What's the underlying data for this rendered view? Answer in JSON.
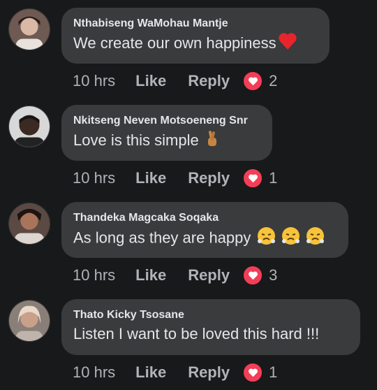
{
  "colors": {
    "background": "#18191a",
    "bubble": "#3a3b3c",
    "text_primary": "#e4e6eb",
    "text_secondary": "#b0b3b8",
    "love_reaction": "#f33e58"
  },
  "comments": [
    {
      "author": "Nthabiseng WaMohau Mantje",
      "text": "We create our own happiness",
      "emoji": "red-heart-emoji",
      "time": "10 hrs",
      "like_label": "Like",
      "reply_label": "Reply",
      "reaction_icon": "love-reaction-icon",
      "reaction_count": "2"
    },
    {
      "author": "Nkitseng Neven Motsoeneng Snr",
      "text": "Love is this simple",
      "emoji": "crossed-fingers-emoji",
      "time": "10 hrs",
      "like_label": "Like",
      "reply_label": "Reply",
      "reaction_icon": "love-reaction-icon",
      "reaction_count": "1"
    },
    {
      "author": "Thandeka Magcaka Soqaka",
      "text": "As long as they are happy",
      "emoji": "face-with-steam-emoji",
      "time": "10 hrs",
      "like_label": "Like",
      "reply_label": "Reply",
      "reaction_icon": "love-reaction-icon",
      "reaction_count": "3"
    },
    {
      "author": "Thato Kicky Tsosane",
      "text": "Listen I want to be loved this hard !!!",
      "emoji": "",
      "time": "10 hrs",
      "like_label": "Like",
      "reply_label": "Reply",
      "reaction_icon": "love-reaction-icon",
      "reaction_count": "1"
    }
  ]
}
